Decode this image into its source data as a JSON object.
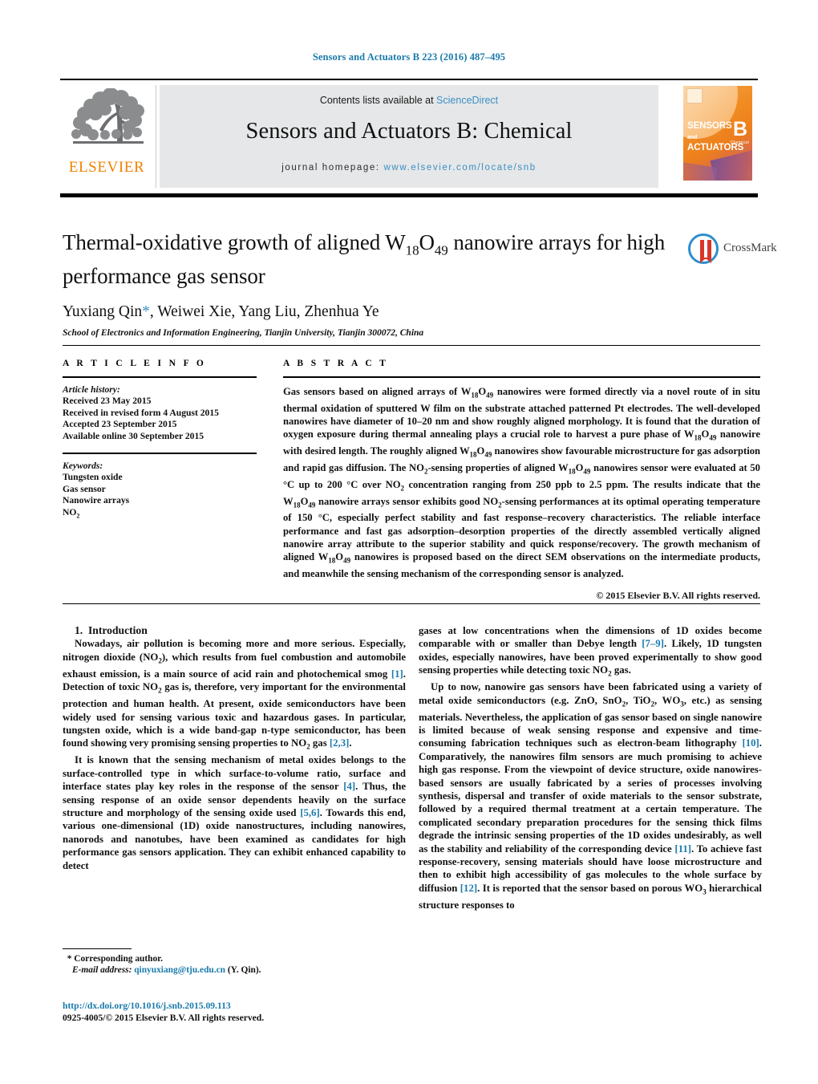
{
  "running_head": "Sensors and Actuators B 223 (2016) 487–495",
  "masthead": {
    "contents_prefix": "Contents lists available at ",
    "sciencedirect": "ScienceDirect",
    "journal_title": "Sensors and Actuators B: Chemical",
    "homepage_prefix": "journal homepage: ",
    "homepage_url": "www.elsevier.com/locate/snb",
    "publisher_logo_text": "ELSEVIER",
    "cover": {
      "line1": "SENSORS",
      "and": "and",
      "line2": "ACTUATORS",
      "letter": "B",
      "subtitle": "Chemical"
    },
    "link_color": "#3a8fc4",
    "brand_orange": "#ef8200"
  },
  "article": {
    "title_part1": "Thermal-oxidative growth of aligned W",
    "title_sub1": "18",
    "title_mid": "O",
    "title_sub2": "49",
    "title_part2": " nanowire arrays for high performance gas sensor",
    "authors": "Yuxiang Qin",
    "corresponding_marker": "*",
    "authors_rest": ", Weiwei Xie, Yang Liu, Zhenhua Ye",
    "affiliation": "School of Electronics and Information Engineering, Tianjin University, Tianjin 300072, China",
    "crossmark_label": "CrossMark"
  },
  "article_info": {
    "heading": "A R T I C L E    I N F O",
    "history_label": "Article history:",
    "history": [
      "Received 23 May 2015",
      "Received in revised form 4 August 2015",
      "Accepted 23 September 2015",
      "Available online 30 September 2015"
    ],
    "keywords_label": "Keywords:",
    "keywords": [
      "Tungsten oxide",
      "Gas sensor",
      "Nanowire arrays",
      "NO2"
    ]
  },
  "abstract": {
    "heading": "A B S T R A C T",
    "text": "Gas sensors based on aligned arrays of W18O49 nanowires were formed directly via a novel route of in situ thermal oxidation of sputtered W film on the substrate attached patterned Pt electrodes. The well-developed nanowires have diameter of 10–20 nm and show roughly aligned morphology. It is found that the duration of oxygen exposure during thermal annealing plays a crucial role to harvest a pure phase of W18O49 nanowire with desired length. The roughly aligned W18O49 nanowires show favourable microstructure for gas adsorption and rapid gas diffusion. The NO2-sensing properties of aligned W18O49 nanowires sensor were evaluated at 50 °C up to 200 °C over NO2 concentration ranging from 250 ppb to 2.5 ppm. The results indicate that the W18O49 nanowire arrays sensor exhibits good NO2-sensing performances at its optimal operating temperature of 150 °C, especially perfect stability and fast response–recovery characteristics. The reliable interface performance and fast gas adsorption–desorption properties of the directly assembled vertically aligned nanowire array attribute to the superior stability and quick response/recovery. The growth mechanism of aligned W18O49 nanowires is proposed based on the direct SEM observations on the intermediate products, and meanwhile the sensing mechanism of the corresponding sensor is analyzed.",
    "copyright": "© 2015 Elsevier B.V. All rights reserved."
  },
  "body": {
    "section_number": "1.",
    "section_title": "Introduction",
    "left_paragraph_1": "Nowadays, air pollution is becoming more and more serious. Especially, nitrogen dioxide (NO2), which results from fuel combustion and automobile exhaust emission, is a main source of acid rain and photochemical smog [1]. Detection of toxic NO2 gas is, therefore, very important for the environmental protection and human health. At present, oxide semiconductors have been widely used for sensing various toxic and hazardous gases. In particular, tungsten oxide, which is a wide band-gap n-type semiconductor, has been found showing very promising sensing properties to NO2 gas [2,3].",
    "left_paragraph_2": "It is known that the sensing mechanism of metal oxides belongs to the surface-controlled type in which surface-to-volume ratio, surface and interface states play key roles in the response of the sensor [4]. Thus, the sensing response of an oxide sensor dependents heavily on the surface structure and morphology of the sensing oxide used [5,6]. Towards this end, various one-dimensional (1D) oxide nanostructures, including nanowires, nanorods and nanotubes, have been examined as candidates for high performance gas sensors application. They can exhibit enhanced capability to detect",
    "right_paragraph_1": "gases at low concentrations when the dimensions of 1D oxides become comparable with or smaller than Debye length [7–9]. Likely, 1D tungsten oxides, especially nanowires, have been proved experimentally to show good sensing properties while detecting toxic NO2 gas.",
    "right_paragraph_2": "Up to now, nanowire gas sensors have been fabricated using a variety of metal oxide semiconductors (e.g. ZnO, SnO2, TiO2, WO3, etc.) as sensing materials. Nevertheless, the application of gas sensor based on single nanowire is limited because of weak sensing response and expensive and time-consuming fabrication techniques such as electron-beam lithography [10]. Comparatively, the nanowires film sensors are much promising to achieve high gas response. From the viewpoint of device structure, oxide nanowires-based sensors are usually fabricated by a series of processes involving synthesis, dispersal and transfer of oxide materials to the sensor substrate, followed by a required thermal treatment at a certain temperature. The complicated secondary preparation procedures for the sensing thick films degrade the intrinsic sensing properties of the 1D oxides undesirably, as well as the stability and reliability of the corresponding device [11]. To achieve fast response-recovery, sensing materials should have loose microstructure and then to exhibit high accessibility of gas molecules to the whole surface by diffusion [12]. It is reported that the sensor based on porous WO3 hierarchical structure responses to"
  },
  "footnotes": {
    "corresponding_marker": "*",
    "corresponding_label": "Corresponding author.",
    "email_label": "E-mail address:",
    "email": "qinyuxiang@tju.edu.cn",
    "email_owner": "(Y. Qin).",
    "doi_url": "http://dx.doi.org/10.1016/j.snb.2015.09.113",
    "issn_line": "0925-4005/© 2015 Elsevier B.V. All rights reserved."
  }
}
